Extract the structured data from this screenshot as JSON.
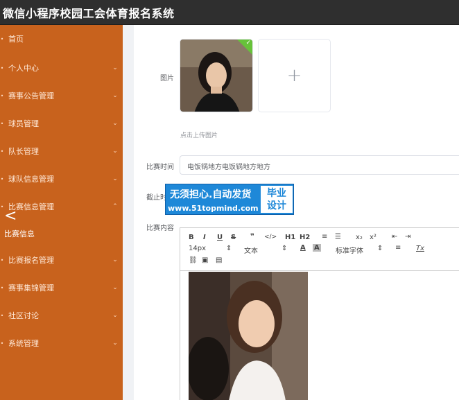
{
  "app": {
    "title": "微信小程序校园工会体育报名系统"
  },
  "sidebar": {
    "items": [
      {
        "label": "首页",
        "has_arrow": false
      },
      {
        "label": "个人中心",
        "has_arrow": true
      },
      {
        "label": "赛事公告管理",
        "has_arrow": true
      },
      {
        "label": "球员管理",
        "has_arrow": true
      },
      {
        "label": "队长管理",
        "has_arrow": true
      },
      {
        "label": "球队信息管理",
        "has_arrow": true
      },
      {
        "label": "比赛信息管理",
        "has_arrow": true
      },
      {
        "label": "比赛报名管理",
        "has_arrow": true
      },
      {
        "label": "赛事集锦管理",
        "has_arrow": true
      },
      {
        "label": "社区讨论",
        "has_arrow": true
      },
      {
        "label": "系统管理",
        "has_arrow": true
      }
    ],
    "sub_item": "比赛信息",
    "arrow_down": "⌄",
    "arrow_up": "⌃",
    "back_arrow": "<"
  },
  "form": {
    "image_label": "图片",
    "upload_plus": "+",
    "upload_tip": "点击上传图片",
    "match_time_label": "比赛时间",
    "match_time_value": "电饭锅地方电饭锅地方地方",
    "deadline_label": "截止时",
    "content_label": "比赛内容"
  },
  "editor": {
    "toolbar_row1": [
      "B",
      "I",
      "U",
      "S",
      "❞",
      "</>",
      "H1",
      "H2",
      "≡",
      "☰",
      "x₂",
      "x²",
      "⇤",
      "⇥"
    ],
    "font_size": "14px",
    "block_format": "文本",
    "font_family": "标准字体",
    "clear_format": "Tx"
  },
  "watermark": {
    "line1": "无须担心.自动发货",
    "line2": "www.51topmind.com",
    "side1": "毕业",
    "side2": "设计"
  },
  "colors": {
    "sidebar_bg": "#c8621d",
    "header_bg": "#2f2f2f",
    "banner_bg": "#1e88d8",
    "success": "#67c23a"
  }
}
